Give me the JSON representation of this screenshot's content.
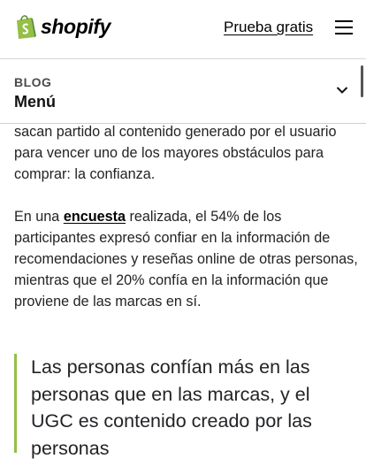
{
  "header": {
    "logo_text": "shopify",
    "trial_link": "Prueba gratis",
    "accent_color": "#95bf47"
  },
  "blog_nav": {
    "section": "BLOG",
    "menu": "Menú"
  },
  "article": {
    "paragraph1": "sacan partido al contenido generado por el usuario para vencer uno de los mayores obstáculos para comprar: la confianza.",
    "paragraph2_before": "En una ",
    "paragraph2_link": "encuesta",
    "paragraph2_after": " realizada, el 54% de los participantes expresó confiar en la información de recomendaciones y reseñas online de otras personas, mientras que el 20% confía en la información que proviene de las marcas en sí.",
    "quote": "Las personas confían más en las personas que en las marcas, y el UGC es contenido creado por las personas"
  },
  "icons": {
    "logo": "shopify-bag-icon",
    "menu": "hamburger-icon",
    "dropdown": "chevron-down-icon"
  }
}
